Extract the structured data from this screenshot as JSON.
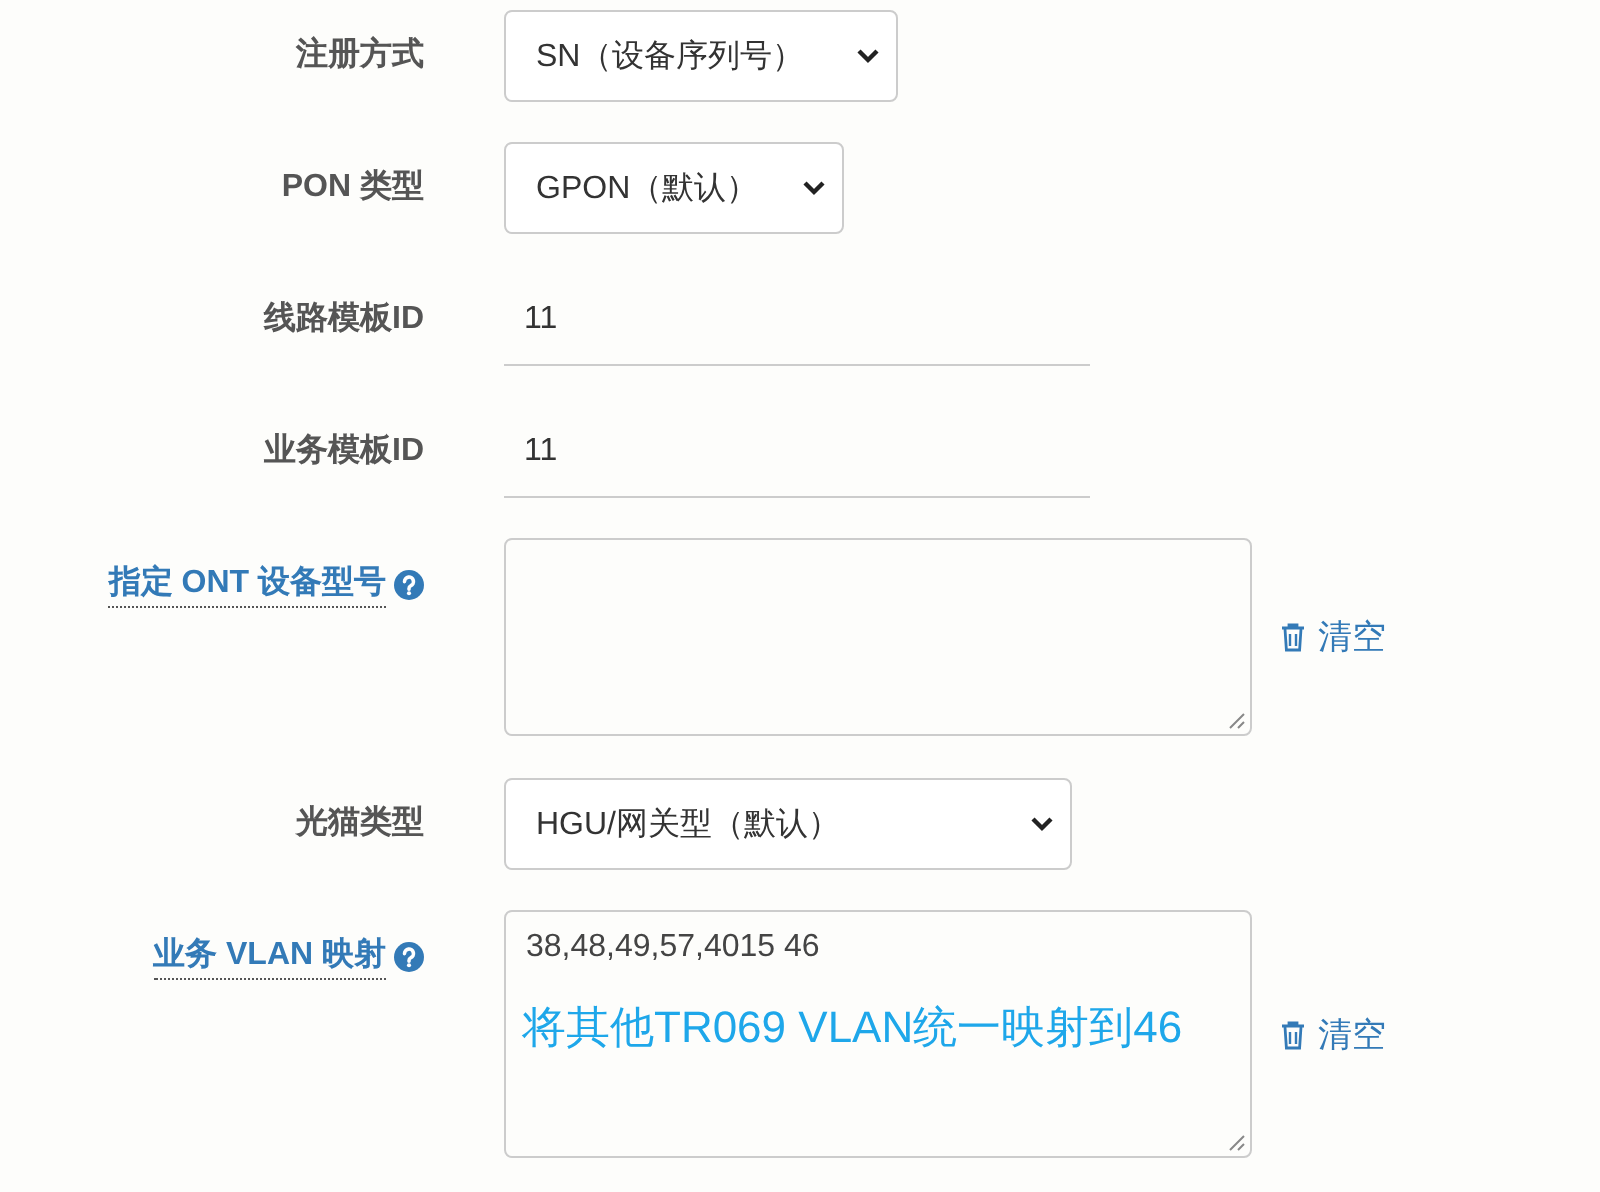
{
  "form": {
    "fields": [
      {
        "kind": "select",
        "label": "注册方式",
        "help": false,
        "value": "SN（设备序列号）"
      },
      {
        "kind": "select",
        "label": "PON 类型",
        "help": false,
        "value": "GPON（默认）"
      },
      {
        "kind": "input",
        "label": "线路模板ID",
        "help": false,
        "value": "11"
      },
      {
        "kind": "input",
        "label": "业务模板ID",
        "help": false,
        "value": "11"
      },
      {
        "kind": "textarea",
        "label": "指定 ONT 设备型号",
        "help": true,
        "clear": "清空"
      },
      {
        "kind": "select",
        "label": "光猫类型",
        "help": false,
        "value": "HGU/网关型（默认）"
      },
      {
        "kind": "textarea",
        "label": "业务 VLAN 映射",
        "help": true,
        "value": "38,48,49,57,4015 46",
        "annotation": "将其他TR069 VLAN统一映射到46",
        "clear": "清空"
      }
    ]
  }
}
